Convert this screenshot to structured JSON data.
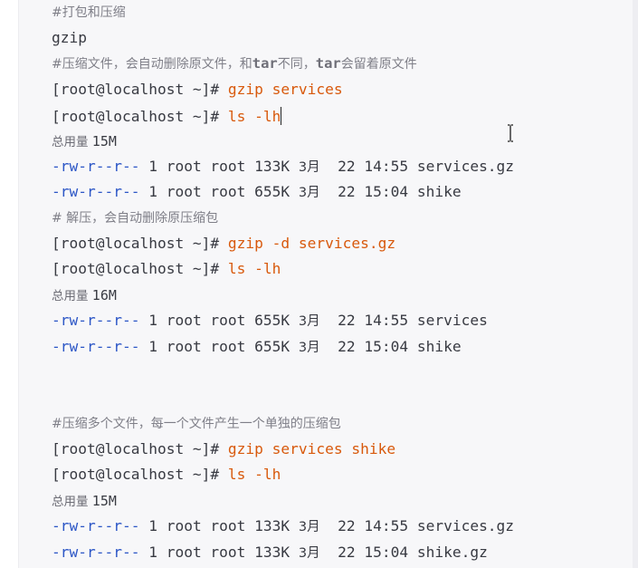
{
  "lines": [
    {
      "kind": "comment",
      "text": "#打包和压缩"
    },
    {
      "kind": "code",
      "parts": [
        {
          "t": "gzip",
          "c": ""
        }
      ]
    },
    {
      "kind": "comment",
      "parts": [
        {
          "t": "#压缩文件，会自动删除原文件，和",
          "c": ""
        },
        {
          "t": "tar",
          "c": "kw"
        },
        {
          "t": "不同，",
          "c": ""
        },
        {
          "t": "tar",
          "c": "kw"
        },
        {
          "t": "会留着原文件",
          "c": ""
        }
      ]
    },
    {
      "kind": "code",
      "parts": [
        {
          "t": "[root@localhost ~]# ",
          "c": ""
        },
        {
          "t": "gzip services",
          "c": "cmd"
        }
      ]
    },
    {
      "kind": "code",
      "cursor": true,
      "parts": [
        {
          "t": "[root@localhost ~]# ",
          "c": ""
        },
        {
          "t": "ls -lh",
          "c": "cmd"
        }
      ]
    },
    {
      "kind": "summary",
      "label": "总用量",
      "value": "15M"
    },
    {
      "kind": "code",
      "parts": [
        {
          "t": "-rw-r--r--",
          "c": "perm"
        },
        {
          "t": " 1 root root 133K ",
          "c": ""
        },
        {
          "t": "3月",
          "c": "month"
        },
        {
          "t": "  22 14:55 services.gz",
          "c": ""
        }
      ]
    },
    {
      "kind": "code",
      "parts": [
        {
          "t": "-rw-r--r--",
          "c": "perm"
        },
        {
          "t": " 1 root root 655K ",
          "c": ""
        },
        {
          "t": "3月",
          "c": "month"
        },
        {
          "t": "  22 15:04 shike",
          "c": ""
        }
      ]
    },
    {
      "kind": "comment",
      "text": "# 解压，会自动删除原压缩包"
    },
    {
      "kind": "code",
      "parts": [
        {
          "t": "[root@localhost ~]# ",
          "c": ""
        },
        {
          "t": "gzip -d services.gz",
          "c": "cmd"
        }
      ]
    },
    {
      "kind": "code",
      "parts": [
        {
          "t": "[root@localhost ~]# ",
          "c": ""
        },
        {
          "t": "ls -lh",
          "c": "cmd"
        }
      ]
    },
    {
      "kind": "summary",
      "label": "总用量",
      "value": "16M"
    },
    {
      "kind": "code",
      "parts": [
        {
          "t": "-rw-r--r--",
          "c": "perm"
        },
        {
          "t": " 1 root root 655K ",
          "c": ""
        },
        {
          "t": "3月",
          "c": "month"
        },
        {
          "t": "  22 14:55 services",
          "c": ""
        }
      ]
    },
    {
      "kind": "code",
      "parts": [
        {
          "t": "-rw-r--r--",
          "c": "perm"
        },
        {
          "t": " 1 root root 655K ",
          "c": ""
        },
        {
          "t": "3月",
          "c": "month"
        },
        {
          "t": "  22 15:04 shike",
          "c": ""
        }
      ]
    },
    {
      "kind": "comment",
      "text": "#压缩多个文件，每一个文件产生一个单独的压缩包"
    },
    {
      "kind": "code",
      "parts": [
        {
          "t": "[root@localhost ~]# ",
          "c": ""
        },
        {
          "t": "gzip services shike",
          "c": "cmd"
        }
      ]
    },
    {
      "kind": "code",
      "parts": [
        {
          "t": "[root@localhost ~]# ",
          "c": ""
        },
        {
          "t": "ls -lh",
          "c": "cmd"
        }
      ]
    },
    {
      "kind": "summary",
      "label": "总用量",
      "value": "15M"
    },
    {
      "kind": "code",
      "parts": [
        {
          "t": "-rw-r--r--",
          "c": "perm"
        },
        {
          "t": " 1 root root 133K ",
          "c": ""
        },
        {
          "t": "3月",
          "c": "month"
        },
        {
          "t": "  22 14:55 services.gz",
          "c": ""
        }
      ]
    },
    {
      "kind": "code",
      "parts": [
        {
          "t": "-rw-r--r--",
          "c": "perm"
        },
        {
          "t": " 1 root root 133K ",
          "c": ""
        },
        {
          "t": "3月",
          "c": "month"
        },
        {
          "t": "  22 15:04 shike.gz",
          "c": ""
        }
      ]
    }
  ],
  "colors": {
    "panel_bg": "#f7f7f9",
    "text": "#383a42",
    "comment": "#7f7f88",
    "command": "#d8590c",
    "permission": "#2c56c6"
  },
  "icons": {
    "mouse_pointer": "text-ibeam-cursor-icon"
  }
}
